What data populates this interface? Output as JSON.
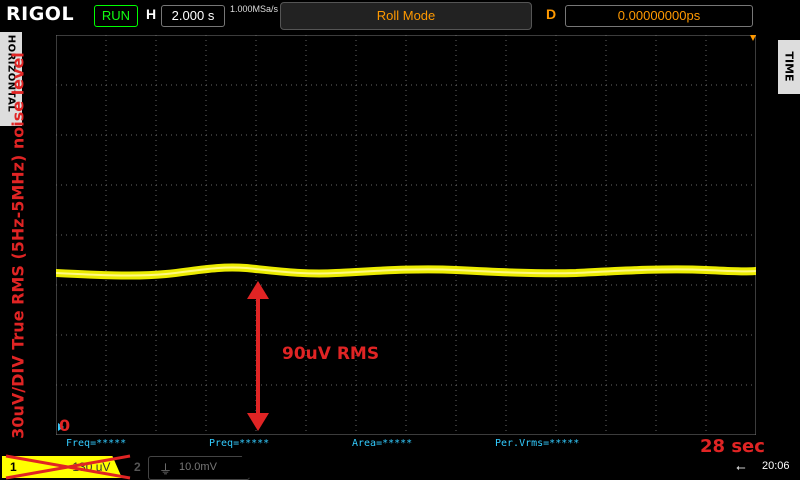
{
  "header": {
    "brand": "RIGOL",
    "run_status": "RUN",
    "horizontal_label": "H",
    "timebase": "2.000 s",
    "sample_rate": "1.000MSa/s",
    "mode": "Roll Mode",
    "delay_label": "D",
    "delay_value": "0.00000000ps"
  },
  "side_tabs": {
    "left": "HORIZONTAL",
    "right": "TIME"
  },
  "annotations": {
    "vertical_note": "30uV/DIV True RMS (5Hz-5MHz) noise level",
    "zero": "0",
    "rms": "90uV RMS",
    "elapsed": "28 sec"
  },
  "measurements": [
    "Freq=*****",
    "Preq=*****",
    "Area=*****",
    "Per.Vrms=*****"
  ],
  "channels": {
    "ch1_number": "1",
    "ch1_value": "~ 130 uV",
    "ch2_number": "2",
    "ch2_value": "10.0mV"
  },
  "status": {
    "clock": "20:06"
  },
  "colors": {
    "trace": "#ffff00",
    "annotation": "#e02424",
    "grid_dots": "#6a6a6a"
  }
}
